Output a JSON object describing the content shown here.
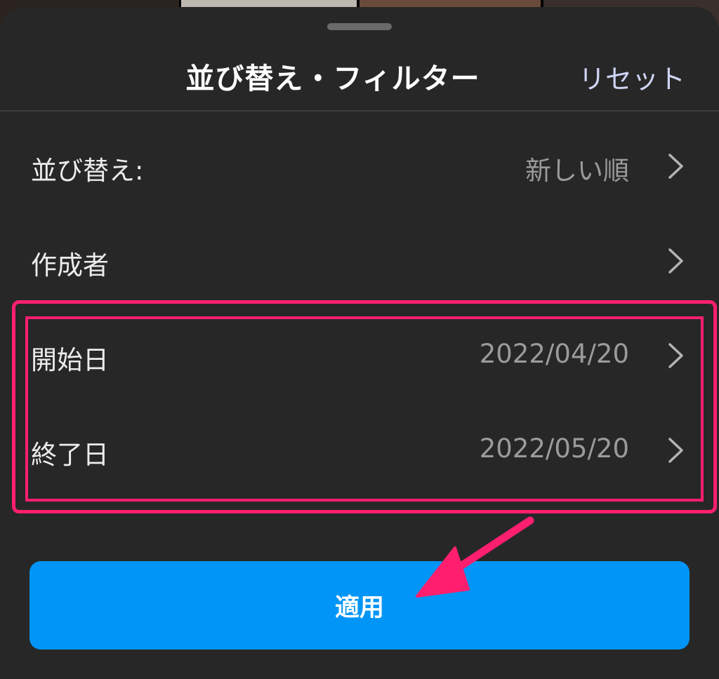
{
  "header": {
    "title": "並び替え・フィルター",
    "reset_label": "リセット"
  },
  "rows": [
    {
      "label": "並び替え:",
      "value": "新しい順"
    },
    {
      "label": "作成者",
      "value": ""
    },
    {
      "label": "開始日",
      "value": "2022/04/20"
    },
    {
      "label": "終了日",
      "value": "2022/05/20"
    }
  ],
  "apply_label": "適用",
  "colors": {
    "sheet_background": "#272727",
    "accent_blue": "#0095f6",
    "highlight_pink": "#ff1f6e",
    "reset_text": "#cfd4f5"
  }
}
